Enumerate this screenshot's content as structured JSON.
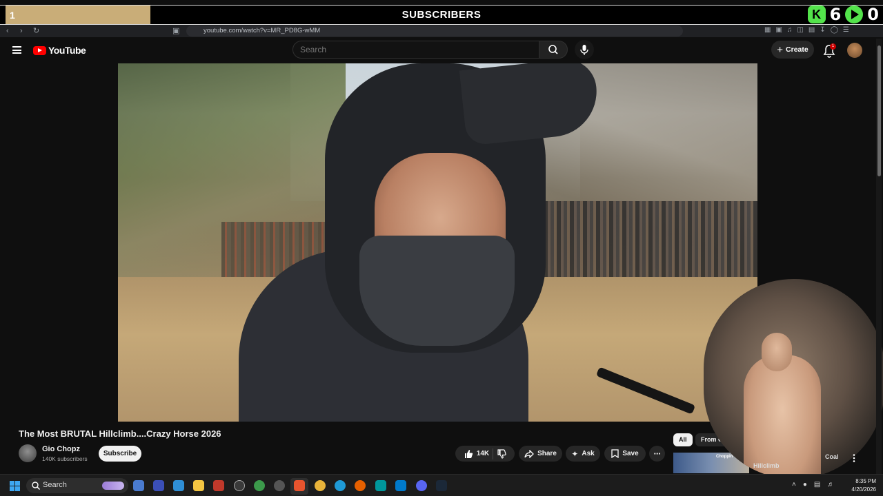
{
  "overlay": {
    "left_badge": "1",
    "title": "SUBSCRIBERS",
    "counter_a": "6",
    "counter_b": "0"
  },
  "browser": {
    "url": "youtube.com/watch?v=MR_PD8G-wMM"
  },
  "header": {
    "logo_text": "YouTube",
    "search_placeholder": "Search",
    "create_label": "Create",
    "notification_count": "1"
  },
  "video": {
    "title": "The Most BRUTAL Hillclimb....Crazy Horse 2026",
    "channel_name": "Gio Chopz",
    "channel_subs": "140K subscribers",
    "subscribe_label": "Subscribe",
    "like_count": "14K",
    "share_label": "Share",
    "ask_label": "Ask",
    "save_label": "Save"
  },
  "sidebar": {
    "chips": [
      "All",
      "From Gio Ch"
    ],
    "rec_title": "Hillclimb",
    "rec_title_2": "Coal",
    "rec_thumb_label": "Choppin Throttles"
  },
  "taskbar": {
    "search_label": "Search",
    "time": "8:35 PM",
    "date": "4/20/2026"
  },
  "colors": {
    "background": "#0f0f0f",
    "brand_red": "#ff0000",
    "overlay_green": "#53e34b",
    "overlay_gold": "#c9ad78",
    "windows_blue": "#3ea7f2"
  }
}
